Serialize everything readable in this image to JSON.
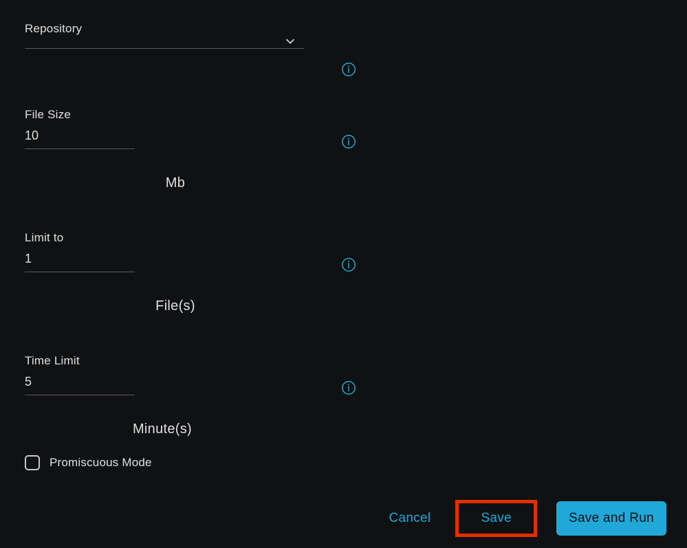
{
  "fields": {
    "repository": {
      "label": "Repository",
      "value": ""
    },
    "file_size": {
      "label": "File Size",
      "value": "10",
      "unit": "Mb"
    },
    "limit_to": {
      "label": "Limit to",
      "value": "1",
      "unit": "File(s)"
    },
    "time_limit": {
      "label": "Time Limit",
      "value": "5",
      "unit": "Minute(s)"
    },
    "promiscuous_mode": {
      "label": "Promiscuous Mode",
      "checked": false
    }
  },
  "buttons": {
    "cancel": "Cancel",
    "save": "Save",
    "save_and_run": "Save and Run"
  }
}
